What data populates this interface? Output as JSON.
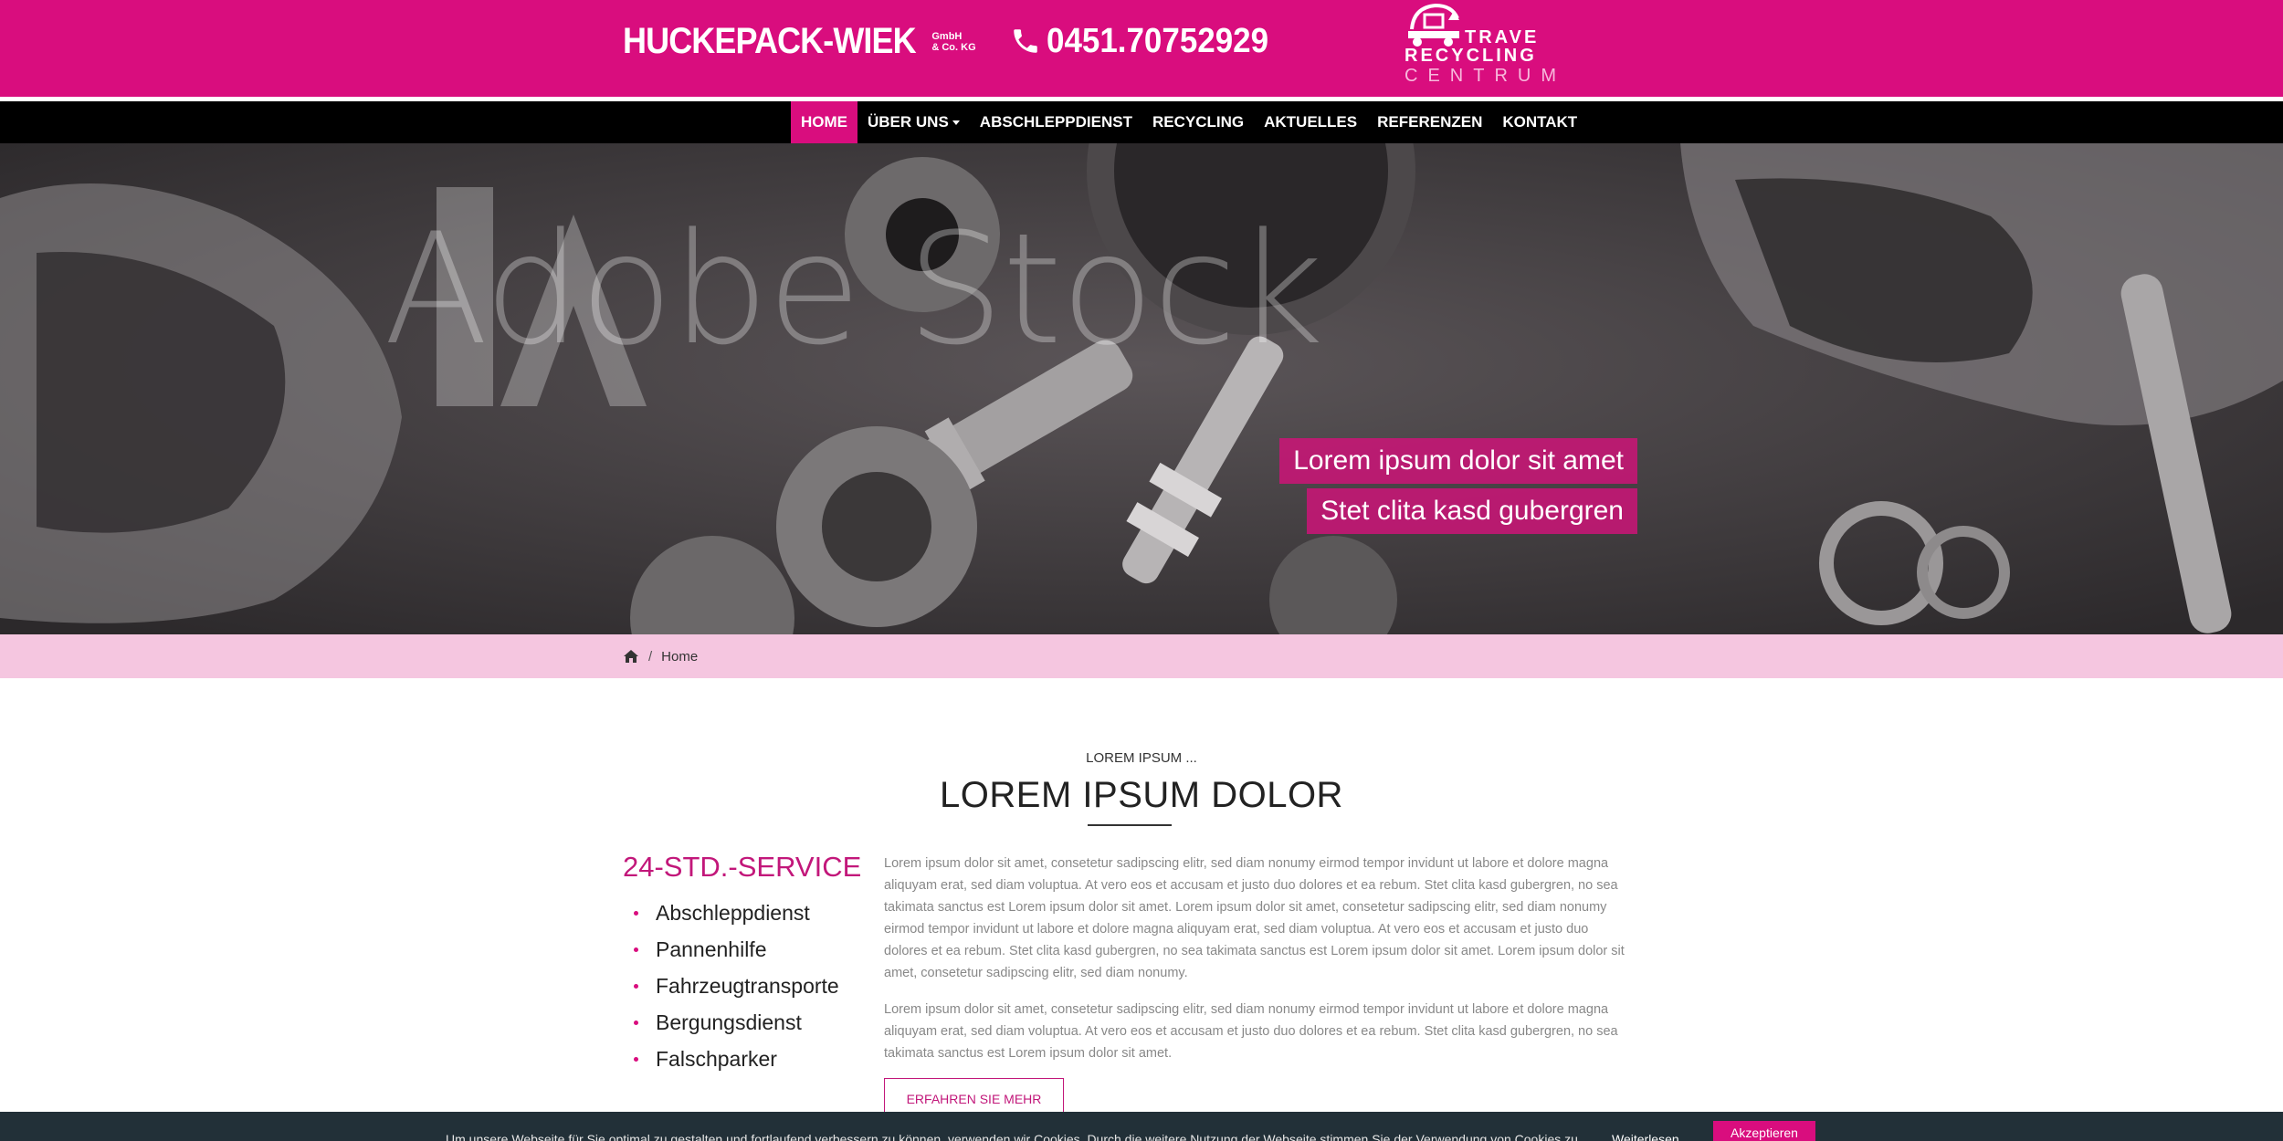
{
  "header": {
    "logo_main": "HUCKEPACK-WIEK",
    "logo_sub_1": "GmbH",
    "logo_sub_2": "& Co. KG",
    "phone": "0451.70752929",
    "partner_line_1": "TRAVE",
    "partner_line_2": "RECYCLING",
    "partner_line_3": "CENTRUM",
    "phone_icon": "phone-icon",
    "brand_color": "#d90d7e"
  },
  "nav": {
    "items": [
      {
        "label": "HOME",
        "active": true
      },
      {
        "label": "ÜBER UNS",
        "has_dropdown": true
      },
      {
        "label": "ABSCHLEPPDIENST"
      },
      {
        "label": "RECYCLING"
      },
      {
        "label": "AKTUELLES"
      },
      {
        "label": "REFERENZEN"
      },
      {
        "label": "KONTAKT"
      }
    ]
  },
  "hero": {
    "watermark": "Adobe Stock",
    "caption_1": "Lorem ipsum dolor sit amet",
    "caption_2": "Stet clita kasd gubergren"
  },
  "breadcrumb": {
    "home_icon": "home-icon",
    "separator": "/",
    "current": "Home"
  },
  "main": {
    "kicker": "LOREM IPSUM ...",
    "heading": "LOREM IPSUM DOLOR",
    "service_title": "24-STD.-SERVICE",
    "services": [
      "Abschleppdienst",
      "Pannenhilfe",
      "Fahrzeugtransporte",
      "Bergungsdienst",
      "Falschparker"
    ],
    "paragraph_1": "Lorem ipsum dolor sit amet, consetetur sadipscing elitr, sed diam nonumy eirmod tempor invidunt ut labore et dolore magna aliquyam erat, sed diam voluptua. At vero eos et accusam et justo duo dolores et ea rebum. Stet clita kasd gubergren, no sea takimata sanctus est Lorem ipsum dolor sit amet. Lorem ipsum dolor sit amet, consetetur sadipscing elitr, sed diam nonumy eirmod tempor invidunt ut labore et dolore magna aliquyam erat, sed diam voluptua. At vero eos et accusam et justo duo dolores et ea rebum. Stet clita kasd gubergren, no sea takimata sanctus est Lorem ipsum dolor sit amet. Lorem ipsum dolor sit amet, consetetur sadipscing elitr, sed diam nonumy.",
    "paragraph_2": "Lorem ipsum dolor sit amet, consetetur sadipscing elitr, sed diam nonumy eirmod tempor invidunt ut labore et dolore magna aliquyam erat, sed diam voluptua. At vero eos et accusam et justo duo dolores et ea rebum. Stet clita kasd gubergren, no sea takimata sanctus est Lorem ipsum dolor sit amet.",
    "more_button": "ERFAHREN SIE MEHR"
  },
  "cookie": {
    "text": "Um unsere Webseite für Sie optimal zu gestalten und fortlaufend verbessern zu können, verwenden wir Cookies. Durch die weitere Nutzung der Webseite stimmen Sie der Verwendung von Cookies zu.",
    "link": "Weiterlesen",
    "accept": "Akzeptieren"
  }
}
